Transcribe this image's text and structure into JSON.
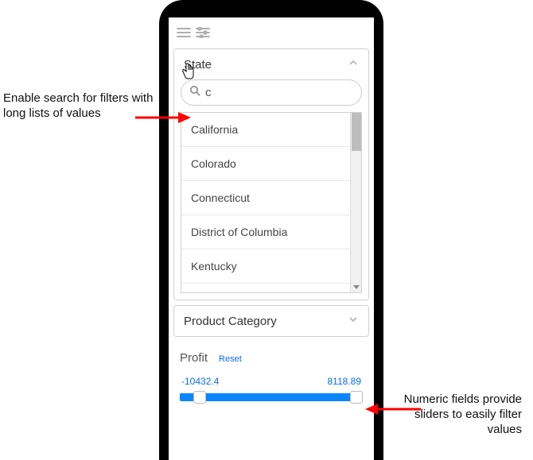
{
  "toolbar": {
    "list_icon": "list",
    "sliders_icon": "sliders"
  },
  "state_panel": {
    "title": "State",
    "search_value": "c",
    "items": [
      "California",
      "Colorado",
      "Connecticut",
      "District of Columbia",
      "Kentucky"
    ]
  },
  "category_panel": {
    "title": "Product Category"
  },
  "profit": {
    "title": "Profit",
    "reset_label": "Reset",
    "min": "-10432.4",
    "max": "8118.89"
  },
  "annotations": {
    "left": "Enable search for filters with long lists of values",
    "right": "Numeric fields provide sliders to easily filter values"
  }
}
